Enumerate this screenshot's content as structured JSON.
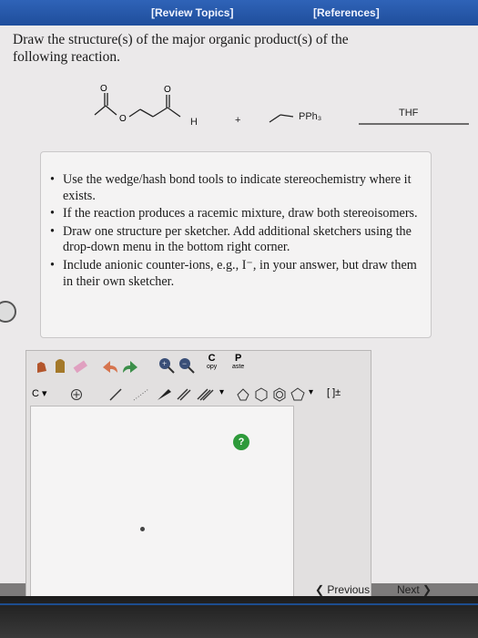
{
  "header": {
    "review_topics": "[Review Topics]",
    "references": "[References]"
  },
  "question": {
    "text": "Draw the structure(s) of the major organic product(s) of the following reaction."
  },
  "reaction": {
    "aldehyde_h": "H",
    "plus": "+",
    "ylide": "PPh₃",
    "solvent": "THF"
  },
  "instructions": [
    "Use the wedge/hash bond tools to indicate stereochemistry where it exists.",
    "If the reaction produces a racemic mixture, draw both stereoisomers.",
    "Draw one structure per sketcher. Add additional sketchers using the drop-down menu in the bottom right corner.",
    "Include anionic counter-ions, e.g., I⁻, in your answer, but draw them in their own sketcher."
  ],
  "editor": {
    "copy_top": "C",
    "copy_bottom": "opy",
    "paste_top": "P",
    "paste_bottom": "aste",
    "atom_select": "C",
    "charge": "[ ]±",
    "help": "?"
  },
  "nav": {
    "previous": "Previous",
    "next": "Next"
  }
}
